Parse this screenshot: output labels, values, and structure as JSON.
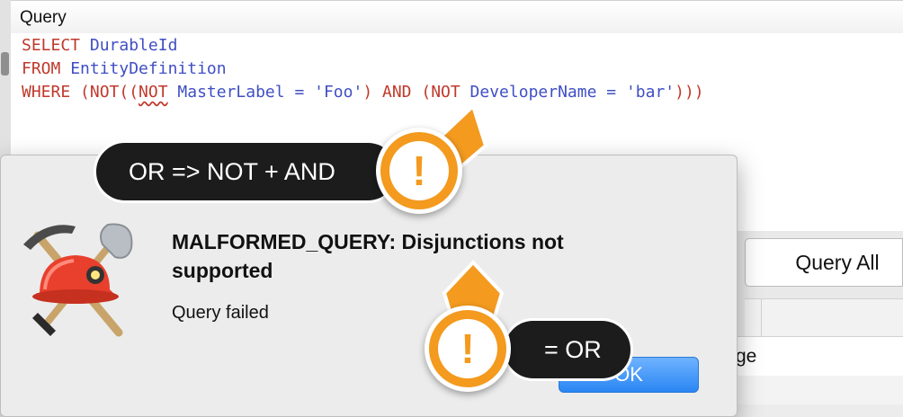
{
  "editor": {
    "query_header": "Query",
    "code": {
      "line1_kw": "SELECT",
      "line1_id": "DurableId",
      "line2_kw": "FROM",
      "line2_id": "EntityDefinition",
      "line3_where": "WHERE",
      "line3_a": " (NOT((",
      "line3_not": "NOT",
      "line3_field1": " MasterLabel = ",
      "line3_val1": "'Foo'",
      "line3_b": ") ",
      "line3_and": "AND",
      "line3_c": " (NOT ",
      "line3_field2": "DeveloperName = ",
      "line3_val2": "'bar'",
      "line3_d": ")))"
    }
  },
  "right_panel": {
    "query_all_label": "Query All",
    "partial_label": "ge"
  },
  "dialog": {
    "title": "MALFORMED_QUERY: Disjunctions not supported",
    "message": "Query failed",
    "ok_label": "OK"
  },
  "callouts": {
    "top_text": "OR => NOT + AND",
    "bottom_text": "= OR",
    "icon_glyph": "!"
  },
  "colors": {
    "accent_orange": "#f39a1f",
    "keyword_red": "#c0392b",
    "identifier_blue": "#3f4fc4",
    "ok_blue": "#2a86f3"
  }
}
